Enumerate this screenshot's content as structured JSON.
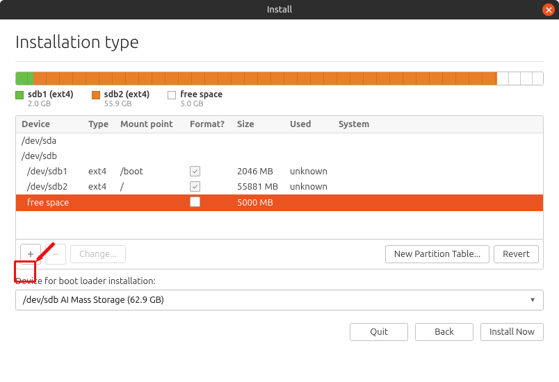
{
  "window": {
    "title": "Install"
  },
  "page": {
    "heading": "Installation type"
  },
  "diskbar": {
    "segments": [
      {
        "class": "green",
        "pct": 3.3
      },
      {
        "class": "orange",
        "pct": 88
      },
      {
        "class": "white",
        "pct": 8.7
      }
    ]
  },
  "legend": [
    {
      "swatch": "green",
      "label": "sdb1 (ext4)",
      "sub": "2.0 GB"
    },
    {
      "swatch": "orange",
      "label": "sdb2 (ext4)",
      "sub": "55.9 GB"
    },
    {
      "swatch": "white",
      "label": "free space",
      "sub": "5.0 GB"
    }
  ],
  "table": {
    "headers": {
      "device": "Device",
      "type": "Type",
      "mount": "Mount point",
      "format": "Format?",
      "size": "Size",
      "used": "Used",
      "system": "System"
    },
    "rows": [
      {
        "device": "/dev/sda",
        "type": "",
        "mount": "",
        "format": null,
        "size": "",
        "used": "",
        "system": "",
        "indent": 0
      },
      {
        "device": "/dev/sdb",
        "type": "",
        "mount": "",
        "format": null,
        "size": "",
        "used": "",
        "system": "",
        "indent": 0
      },
      {
        "device": "/dev/sdb1",
        "type": "ext4",
        "mount": "/boot",
        "format": true,
        "size": "2046 MB",
        "used": "unknown",
        "system": "",
        "indent": 1
      },
      {
        "device": "/dev/sdb2",
        "type": "ext4",
        "mount": "/",
        "format": true,
        "size": "55881 MB",
        "used": "unknown",
        "system": "",
        "indent": 1
      },
      {
        "device": "free space",
        "type": "",
        "mount": "",
        "format": false,
        "size": "5000 MB",
        "used": "",
        "system": "",
        "selected": true,
        "indent": 1
      }
    ]
  },
  "tblbtns": {
    "add": "+",
    "remove": "−",
    "change": "Change...",
    "newtable": "New Partition Table...",
    "revert": "Revert"
  },
  "bootloader": {
    "label": "Device for boot loader installation:",
    "value": "/dev/sdb   AI Mass Storage (62.9 GB)"
  },
  "footer": {
    "quit": "Quit",
    "back": "Back",
    "install": "Install Now"
  }
}
